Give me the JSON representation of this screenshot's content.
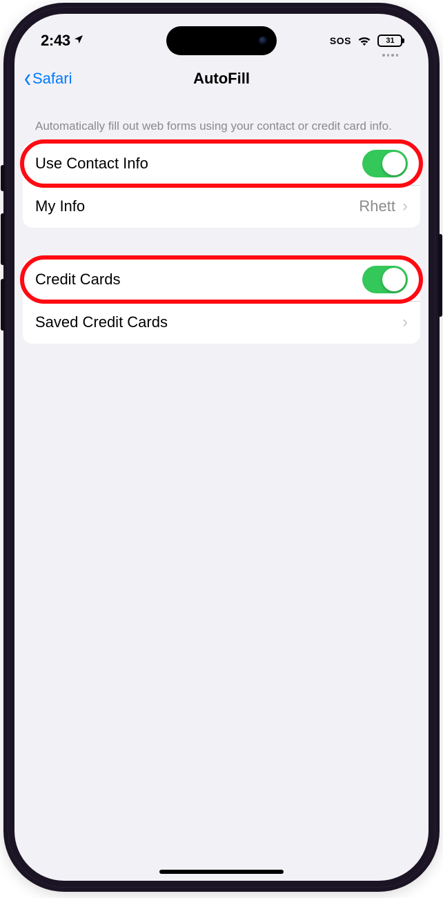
{
  "status": {
    "time": "2:43",
    "sos": "SOS",
    "battery_pct": "31"
  },
  "nav": {
    "back_label": "Safari",
    "title": "AutoFill"
  },
  "section_desc": "Automatically fill out web forms using your contact or credit card info.",
  "group1": {
    "use_contact_label": "Use Contact Info",
    "my_info_label": "My Info",
    "my_info_value": "Rhett"
  },
  "group2": {
    "credit_cards_label": "Credit Cards",
    "saved_label": "Saved Credit Cards"
  }
}
